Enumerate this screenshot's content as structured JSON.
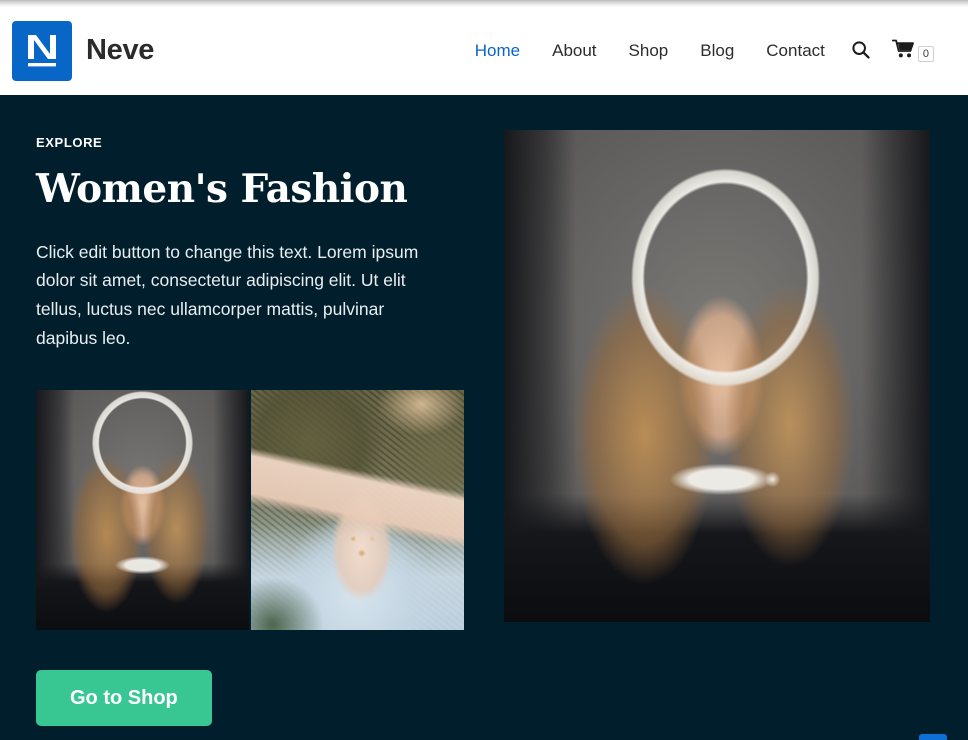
{
  "header": {
    "brand": {
      "name": "Neve",
      "logo_icon": "neve-n-logo",
      "logo_color": "#0866c6"
    },
    "nav": [
      {
        "label": "Home",
        "active": true
      },
      {
        "label": "About",
        "active": false
      },
      {
        "label": "Shop",
        "active": false
      },
      {
        "label": "Blog",
        "active": false
      },
      {
        "label": "Contact",
        "active": false
      }
    ],
    "search_icon": "search-icon",
    "cart_icon": "shopping-cart-icon",
    "cart_count": "0"
  },
  "hero": {
    "eyebrow": "EXPLORE",
    "title": "Women's Fashion",
    "paragraph": "Click edit button to change this text. Lorem ipsum dolor sit amet, consectetur adipiscing elit. Ut elit tellus, luctus nec ullamcorper mattis, pulvinar dapibus leo.",
    "cta_label": "Go to Shop",
    "cta_color": "#38c793",
    "background_color": "#001e2b",
    "gallery": [
      {
        "alt": "Blonde woman wearing black hoodie on grey studio backdrop"
      },
      {
        "alt": "Hands with gold rings resting on pale blue dress with olive knit sweater"
      }
    ],
    "feature_image": {
      "alt": "Blonde woman pulling hood over her head, grey studio backdrop"
    }
  },
  "scroll_top": {
    "label": "Scroll to top"
  }
}
